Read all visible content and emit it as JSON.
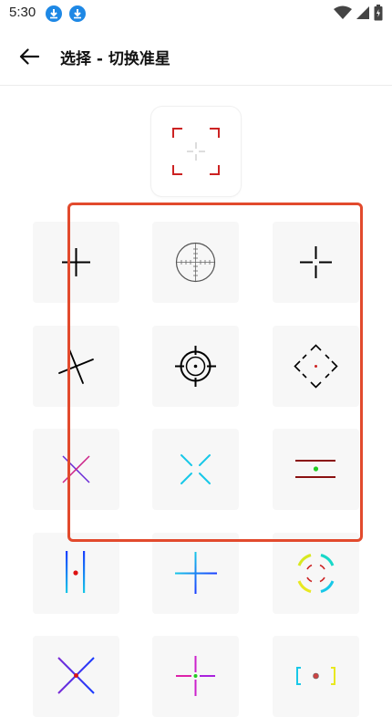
{
  "status_bar": {
    "time": "5:30",
    "icons": [
      "download-icon",
      "download-icon",
      "wifi-icon",
      "signal-icon",
      "battery-icon"
    ]
  },
  "header": {
    "title": "选择 - 切换准星",
    "back_icon": "arrow-left-icon"
  },
  "preview": {
    "selected": "corner-brackets-crosshair"
  },
  "crosshairs": [
    "plus",
    "scope-circle",
    "plus-gap",
    "pinwheel",
    "target-reticle",
    "dashed-diamond",
    "purple-x",
    "cyan-x-gap",
    "double-lines-dot",
    "vertical-bars-dot",
    "gradient-plus",
    "color-ring",
    "gradient-x-dot",
    "magenta-plus",
    "bracket-dot"
  ],
  "colors": {
    "highlight_border": "#e24a2d",
    "tile_background": "#f7f7f7",
    "status_icon_blue": "#1e88e5",
    "preview_red": "#cc2222"
  }
}
